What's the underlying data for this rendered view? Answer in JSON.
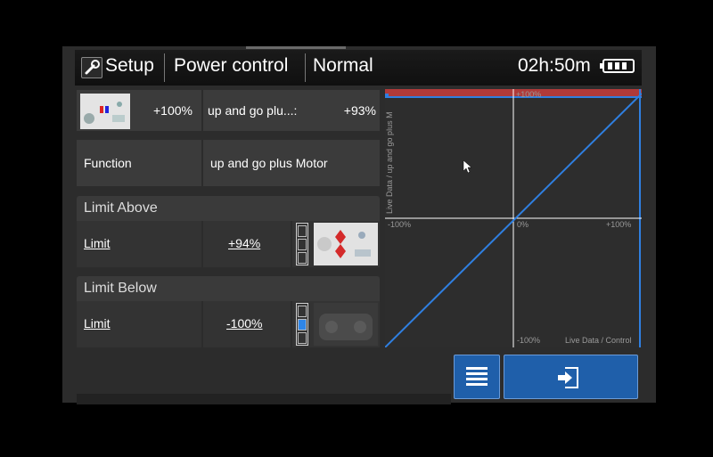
{
  "header": {
    "setup_label": "Setup",
    "power_label": "Power control",
    "mode_label": "Normal",
    "timer": "02h:50m",
    "battery_level": 1.0
  },
  "row1": {
    "left_value": "+100%",
    "function_name": "up and go plu...:",
    "function_value": "+93%"
  },
  "function_row": {
    "label": "Function",
    "value": "up and go plus Motor"
  },
  "limit_above": {
    "title": "Limit Above",
    "label": "Limit",
    "value": "+94%"
  },
  "limit_below": {
    "title": "Limit Below",
    "label": "Limit",
    "value": "-100%"
  },
  "graph": {
    "top_label": "+100%",
    "bottom_label": "-100%",
    "left_label": "-100%",
    "center_label": "0%",
    "right_label": "+100%",
    "x_axis_label": "Live Data / Control",
    "y_axis_label": "Live Data / up and go plus M",
    "colors": {
      "line": "#2f7fe0",
      "limit_band": "#b03a3a",
      "axis": "#ffffff"
    }
  },
  "buttons": {
    "menu_icon": "list-icon",
    "enter_icon": "sign-in-icon"
  }
}
